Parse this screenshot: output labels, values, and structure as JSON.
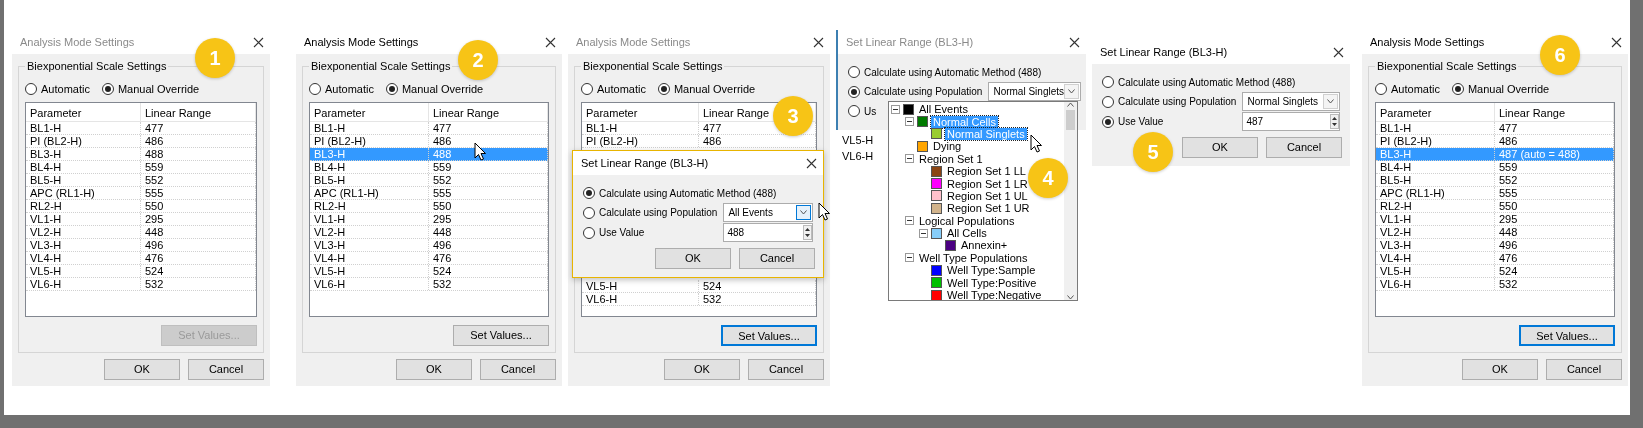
{
  "steps": [
    {
      "kind": "settings",
      "badge": "1",
      "title": "Analysis Mode Settings",
      "active": false,
      "group_label": "Biexponential Scale Settings",
      "modes": [
        {
          "label": "Automatic",
          "selected": false
        },
        {
          "label": "Manual Override",
          "selected": true
        }
      ],
      "columns": [
        "Parameter",
        "Linear Range"
      ],
      "rows": [
        {
          "cells": [
            "BL1-H",
            "477"
          ],
          "selected": false
        },
        {
          "cells": [
            "PI (BL2-H)",
            "486"
          ],
          "selected": false
        },
        {
          "cells": [
            "BL3-H",
            "488"
          ],
          "selected": false
        },
        {
          "cells": [
            "BL4-H",
            "559"
          ],
          "selected": false
        },
        {
          "cells": [
            "BL5-H",
            "552"
          ],
          "selected": false
        },
        {
          "cells": [
            "APC (RL1-H)",
            "555"
          ],
          "selected": false
        },
        {
          "cells": [
            "RL2-H",
            "550"
          ],
          "selected": false
        },
        {
          "cells": [
            "VL1-H",
            "295"
          ],
          "selected": false
        },
        {
          "cells": [
            "VL2-H",
            "448"
          ],
          "selected": false
        },
        {
          "cells": [
            "VL3-H",
            "496"
          ],
          "selected": false
        },
        {
          "cells": [
            "VL4-H",
            "476"
          ],
          "selected": false
        },
        {
          "cells": [
            "VL5-H",
            "524"
          ],
          "selected": false
        },
        {
          "cells": [
            "VL6-H",
            "532"
          ],
          "selected": false
        }
      ],
      "set_values": {
        "label": "Set Values...",
        "disabled": true,
        "focused": false
      },
      "buttons": [
        "OK",
        "Cancel"
      ]
    },
    {
      "kind": "settings",
      "badge": "2",
      "title": "Analysis Mode Settings",
      "active": true,
      "group_label": "Biexponential Scale Settings",
      "cursor": true,
      "modes": [
        {
          "label": "Automatic",
          "selected": false
        },
        {
          "label": "Manual Override",
          "selected": true
        }
      ],
      "columns": [
        "Parameter",
        "Linear Range"
      ],
      "rows": [
        {
          "cells": [
            "BL1-H",
            "477"
          ],
          "selected": false
        },
        {
          "cells": [
            "PI (BL2-H)",
            "486"
          ],
          "selected": false
        },
        {
          "cells": [
            "BL3-H",
            "488"
          ],
          "selected": true
        },
        {
          "cells": [
            "BL4-H",
            "559"
          ],
          "selected": false
        },
        {
          "cells": [
            "BL5-H",
            "552"
          ],
          "selected": false
        },
        {
          "cells": [
            "APC (RL1-H)",
            "555"
          ],
          "selected": false
        },
        {
          "cells": [
            "RL2-H",
            "550"
          ],
          "selected": false
        },
        {
          "cells": [
            "VL1-H",
            "295"
          ],
          "selected": false
        },
        {
          "cells": [
            "VL2-H",
            "448"
          ],
          "selected": false
        },
        {
          "cells": [
            "VL3-H",
            "496"
          ],
          "selected": false
        },
        {
          "cells": [
            "VL4-H",
            "476"
          ],
          "selected": false
        },
        {
          "cells": [
            "VL5-H",
            "524"
          ],
          "selected": false
        },
        {
          "cells": [
            "VL6-H",
            "532"
          ],
          "selected": false
        }
      ],
      "set_values": {
        "label": "Set Values...",
        "disabled": false,
        "focused": false
      },
      "buttons": [
        "OK",
        "Cancel"
      ]
    },
    {
      "kind": "settings",
      "badge": "3",
      "title": "Analysis Mode Settings",
      "active": false,
      "group_label": "Biexponential Scale Settings",
      "cursor": true,
      "modes": [
        {
          "label": "Automatic",
          "selected": false
        },
        {
          "label": "Manual Override",
          "selected": true
        }
      ],
      "columns": [
        "Parameter",
        "Linear Range"
      ],
      "rows": [
        {
          "cells": [
            "BL1-H",
            "477"
          ],
          "selected": false
        },
        {
          "cells": [
            "PI (BL2-H)",
            "486"
          ],
          "selected": false
        }
      ],
      "popup": {
        "title": "Set Linear Range (BL3-H)",
        "active": true,
        "options": [
          {
            "kind": "plain",
            "label": "Calculate using Automatic Method (488)",
            "selected": true
          },
          {
            "kind": "population",
            "label": "Calculate using Population",
            "selected": false,
            "value": "All Events",
            "hover": true
          },
          {
            "kind": "number",
            "label": "Use Value",
            "selected": false,
            "value": "488"
          }
        ],
        "buttons": [
          "OK",
          "Cancel"
        ]
      },
      "rows_after": [
        {
          "cells": [
            "VL5-H",
            "524"
          ],
          "selected": false
        },
        {
          "cells": [
            "VL6-H",
            "532"
          ],
          "selected": false
        }
      ],
      "set_values": {
        "label": "Set Values...",
        "disabled": false,
        "focused": true
      },
      "buttons": [
        "OK",
        "Cancel"
      ]
    },
    {
      "kind": "tree_popup",
      "badge": "4",
      "title": "Set Linear Range (BL3-H)",
      "active": false,
      "cursor": true,
      "options": [
        {
          "kind": "plain",
          "label": "Calculate using Automatic Method (488)",
          "selected": false
        },
        {
          "kind": "population",
          "label": "Calculate using Population",
          "selected": true,
          "value": "Normal Singlets",
          "hover": false
        },
        {
          "kind": "plain",
          "label": "Us",
          "selected": false
        }
      ],
      "behind_rows": [
        "VL5-H",
        "VL6-H"
      ],
      "tree": [
        {
          "label": "All Events",
          "color": "#000000",
          "selected": false,
          "children": [
            {
              "label": "Normal Cells",
              "color": "#007a00",
              "selected": true,
              "children": [
                {
                  "label": "Normal Singlets",
                  "color": "#9acd32",
                  "selected": true
                }
              ]
            },
            {
              "label": "Dying",
              "color": "#ffa500",
              "selected": false
            },
            {
              "label": "Region Set 1",
              "selected": false,
              "children": [
                {
                  "label": "Region Set 1 LL",
                  "color": "#8b4513",
                  "selected": false
                },
                {
                  "label": "Region Set 1 LR",
                  "color": "#ff00ff",
                  "selected": false
                },
                {
                  "label": "Region Set 1 UL",
                  "color": "#ffc0cb",
                  "selected": false
                },
                {
                  "label": "Region Set 1 UR",
                  "color": "#d2b48c",
                  "selected": false
                }
              ]
            },
            {
              "label": "Logical Populations",
              "selected": false,
              "children": [
                {
                  "label": "All Cells",
                  "color": "#87cefa",
                  "selected": false,
                  "children": [
                    {
                      "label": "Annexin+",
                      "color": "#4b0082",
                      "selected": false
                    }
                  ]
                }
              ]
            },
            {
              "label": "Well Type Populations",
              "selected": false,
              "children": [
                {
                  "label": "Well Type:Sample",
                  "color": "#0000ff",
                  "selected": false
                },
                {
                  "label": "Well Type:Positive",
                  "color": "#00c000",
                  "selected": false
                },
                {
                  "label": "Well Type:Negative",
                  "color": "#ff0000",
                  "selected": false
                }
              ]
            }
          ]
        }
      ]
    },
    {
      "kind": "linear_range",
      "badge": "5",
      "title": "Set Linear Range (BL3-H)",
      "active": true,
      "options": [
        {
          "kind": "plain",
          "label": "Calculate using Automatic Method (488)",
          "selected": false
        },
        {
          "kind": "population",
          "label": "Calculate using Population",
          "selected": false,
          "value": "Normal Singlets",
          "hover": false
        },
        {
          "kind": "number",
          "label": "Use Value",
          "selected": true,
          "value": "487"
        }
      ],
      "buttons": [
        "OK",
        "Cancel"
      ]
    },
    {
      "kind": "settings",
      "badge": "6",
      "title": "Analysis Mode Settings",
      "active": true,
      "group_label": "Biexponential Scale Settings",
      "modes": [
        {
          "label": "Automatic",
          "selected": false
        },
        {
          "label": "Manual Override",
          "selected": true
        }
      ],
      "columns": [
        "Parameter",
        "Linear Range"
      ],
      "rows": [
        {
          "cells": [
            "BL1-H",
            "477"
          ],
          "selected": false
        },
        {
          "cells": [
            "PI (BL2-H)",
            "486"
          ],
          "selected": false
        },
        {
          "cells": [
            "BL3-H",
            "487 (auto = 488)"
          ],
          "selected": true
        },
        {
          "cells": [
            "BL4-H",
            "559"
          ],
          "selected": false
        },
        {
          "cells": [
            "BL5-H",
            "552"
          ],
          "selected": false
        },
        {
          "cells": [
            "APC (RL1-H)",
            "555"
          ],
          "selected": false
        },
        {
          "cells": [
            "RL2-H",
            "550"
          ],
          "selected": false
        },
        {
          "cells": [
            "VL1-H",
            "295"
          ],
          "selected": false
        },
        {
          "cells": [
            "VL2-H",
            "448"
          ],
          "selected": false
        },
        {
          "cells": [
            "VL3-H",
            "496"
          ],
          "selected": false
        },
        {
          "cells": [
            "VL4-H",
            "476"
          ],
          "selected": false
        },
        {
          "cells": [
            "VL5-H",
            "524"
          ],
          "selected": false
        },
        {
          "cells": [
            "VL6-H",
            "532"
          ],
          "selected": false
        }
      ],
      "set_values": {
        "label": "Set Values...",
        "disabled": false,
        "focused": true
      },
      "buttons": [
        "OK",
        "Cancel"
      ]
    }
  ]
}
